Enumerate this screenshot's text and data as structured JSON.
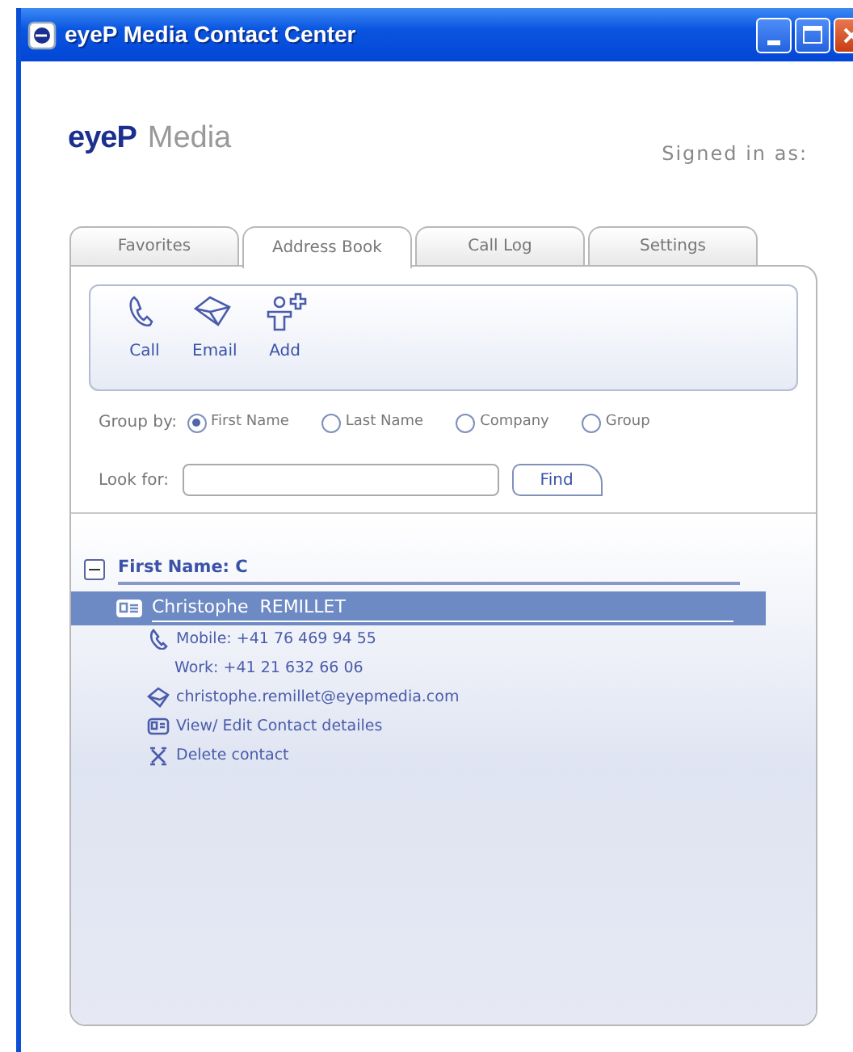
{
  "window": {
    "title": "eyeP Media Contact Center"
  },
  "header": {
    "brand": "eyeP",
    "brand_suffix": "Media",
    "signed_in": "Signed in as:"
  },
  "tabs": [
    {
      "label": "Favorites",
      "selected": false
    },
    {
      "label": "Address Book",
      "selected": true
    },
    {
      "label": "Call Log",
      "selected": false
    },
    {
      "label": "Settings",
      "selected": false
    }
  ],
  "toolbar": [
    {
      "label": "Call",
      "kind": "call"
    },
    {
      "label": "Email",
      "kind": "email"
    },
    {
      "label": "Add",
      "kind": "add"
    }
  ],
  "group_by": {
    "label": "Group by:",
    "options": [
      {
        "label": "First Name",
        "selected": true
      },
      {
        "label": "Last Name",
        "selected": false
      },
      {
        "label": "Company",
        "selected": false
      },
      {
        "label": "Group",
        "selected": false
      }
    ]
  },
  "search": {
    "label": "Look for:",
    "button": "Find"
  },
  "tree": [
    {
      "label": "First Name: C",
      "expanded": true,
      "children": [
        {
          "name": "Christophe  REMILLET",
          "selected": true,
          "details": [
            {
              "kind": "phone",
              "text": "Mobile: +41 76 469 94 55"
            },
            {
              "kind": "plain",
              "text": "Work: +41 21 632 66 06"
            },
            {
              "kind": "email",
              "text": "christophe.remillet@eyepmedia.com"
            },
            {
              "kind": "card",
              "text": "View/ Edit Contact detailes"
            },
            {
              "kind": "delete",
              "text": "Delete contact"
            }
          ]
        }
      ]
    }
  ]
}
